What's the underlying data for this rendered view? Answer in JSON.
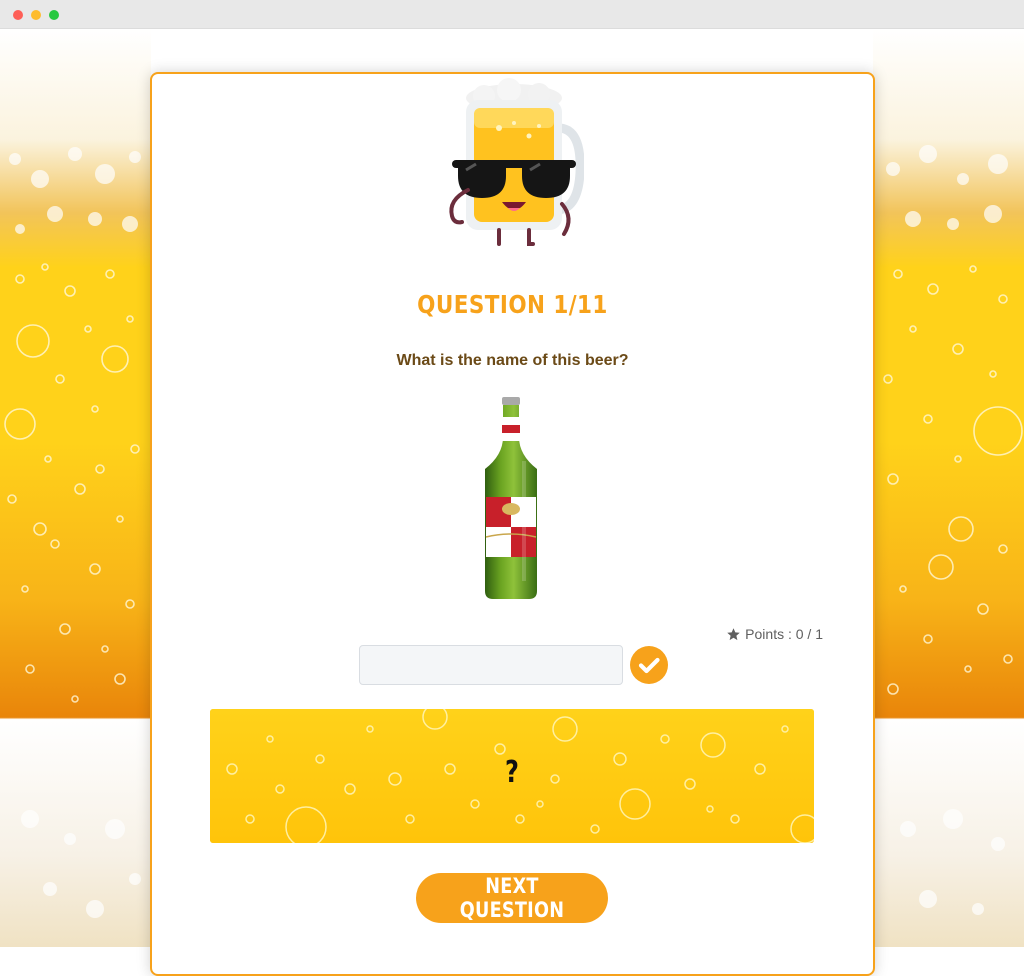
{
  "quiz": {
    "question_title": "QUESTION 1/11",
    "question_text": "What is the name of this beer?",
    "points_label": "Points : 0 / 1",
    "answer_value": "",
    "answer_placeholder": "",
    "reveal_text": "?",
    "next_button_label": "NEXT QUESTION"
  },
  "icons": {
    "mascot": "beer-mug-mascot-with-sunglasses",
    "product": "green-beer-bottle",
    "points": "star-icon",
    "submit": "check-icon"
  },
  "colors": {
    "accent": "#f7a21b",
    "question_text": "#6b4a17",
    "beer_yellow": "#ffd21a",
    "beer_orange": "#f09a0b"
  }
}
